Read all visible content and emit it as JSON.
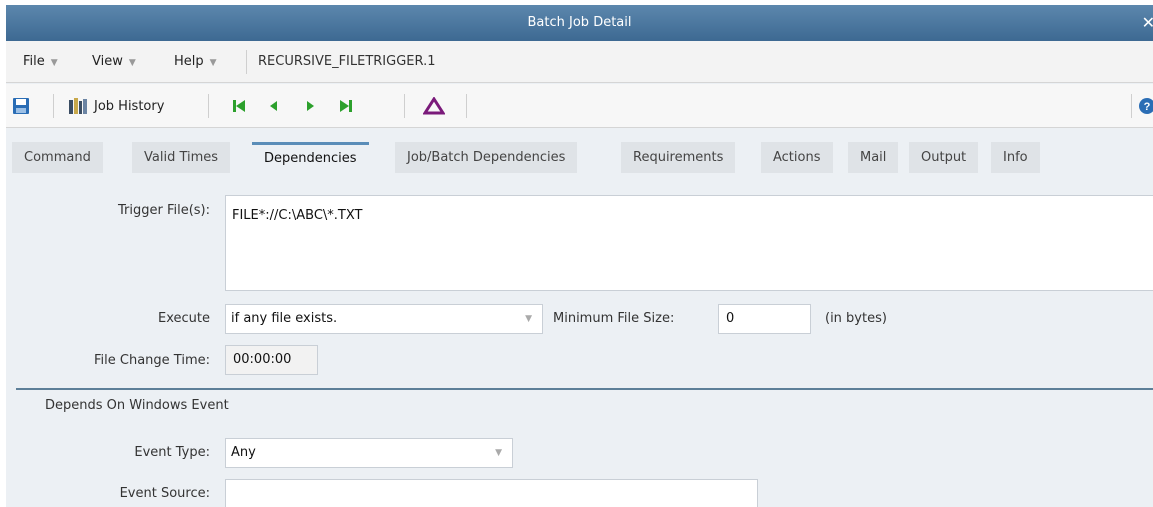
{
  "window": {
    "title": "Batch Job Detail",
    "close_glyph": "✕"
  },
  "menubar": {
    "items": [
      {
        "label": "File"
      },
      {
        "label": "View"
      },
      {
        "label": "Help"
      }
    ],
    "job_name": "RECURSIVE_FILETRIGGER.1"
  },
  "toolbar": {
    "job_history_label": "Job History",
    "icons": [
      "save-icon",
      "job-history-icon",
      "first-record-icon",
      "previous-record-icon",
      "next-record-icon",
      "last-record-icon",
      "delta-icon",
      "help-icon"
    ],
    "colors": {
      "nav_green": "#2ca02c",
      "delta_purple": "#7a1a7a",
      "save_blue": "#2a6db5"
    }
  },
  "tabs": [
    {
      "label": "Command"
    },
    {
      "label": "Valid Times"
    },
    {
      "label": "Dependencies"
    },
    {
      "label": "Job/Batch Dependencies"
    },
    {
      "label": "Requirements"
    },
    {
      "label": "Actions"
    },
    {
      "label": "Mail"
    },
    {
      "label": "Output"
    },
    {
      "label": "Info"
    }
  ],
  "form": {
    "trigger_files_label": "Trigger File(s):",
    "trigger_files_value": "FILE*://C:\\ABC\\*.TXT",
    "execute_label": "Execute",
    "execute_value": "if any file exists.",
    "min_file_size_label": "Minimum File Size:",
    "min_file_size_value": "0",
    "min_file_size_unit": "(in bytes)",
    "file_change_time_label": "File Change Time:",
    "file_change_time_value": "00:00:00",
    "windows_event_section": "Depends On Windows Event",
    "event_type_label": "Event Type:",
    "event_type_value": "Any",
    "event_source_label": "Event Source:",
    "event_source_value": ""
  }
}
